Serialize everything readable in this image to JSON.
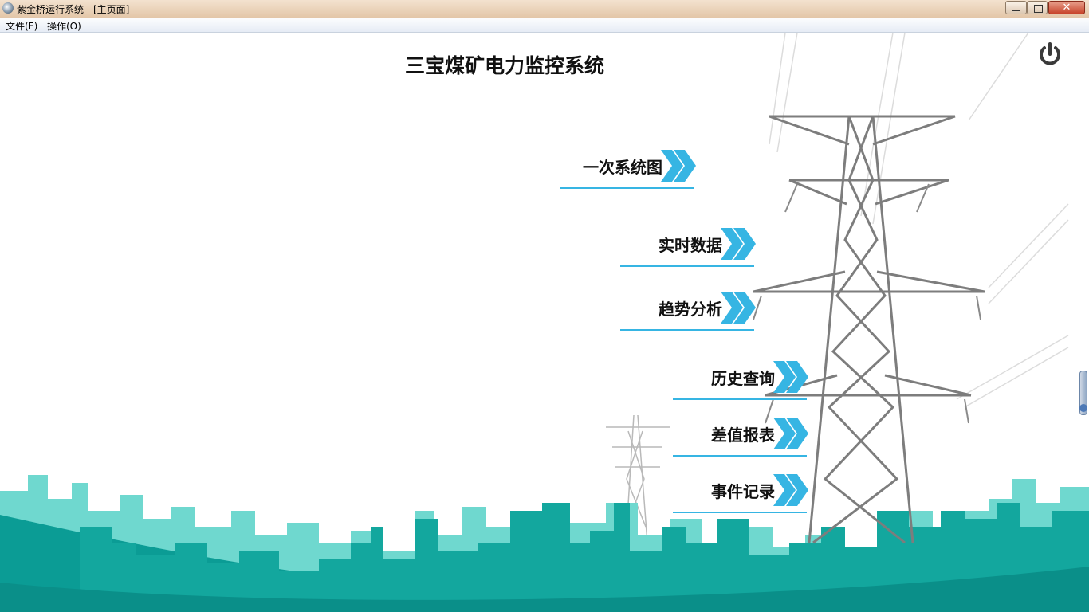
{
  "window": {
    "title": "紫金桥运行系统 - [主页面]"
  },
  "menu": {
    "items": [
      {
        "label": "文件(F)"
      },
      {
        "label": "操作(O)"
      }
    ]
  },
  "main": {
    "heading": "三宝煤矿电力监控系统",
    "power_icon": "power-icon",
    "nav": [
      {
        "label": "一次系统图",
        "icon": "chevron-double-right-icon"
      },
      {
        "label": "实时数据",
        "icon": "chevron-double-right-icon"
      },
      {
        "label": "趋势分析",
        "icon": "chevron-double-right-icon"
      },
      {
        "label": "历史查询",
        "icon": "chevron-double-right-icon"
      },
      {
        "label": "差值报表",
        "icon": "chevron-double-right-icon"
      },
      {
        "label": "事件记录",
        "icon": "chevron-double-right-icon"
      }
    ]
  },
  "colors": {
    "accent": "#36b5e3",
    "teal_dark": "#0b9c95",
    "teal_light": "#6fd8cf",
    "tower": "#7d7d7d"
  }
}
